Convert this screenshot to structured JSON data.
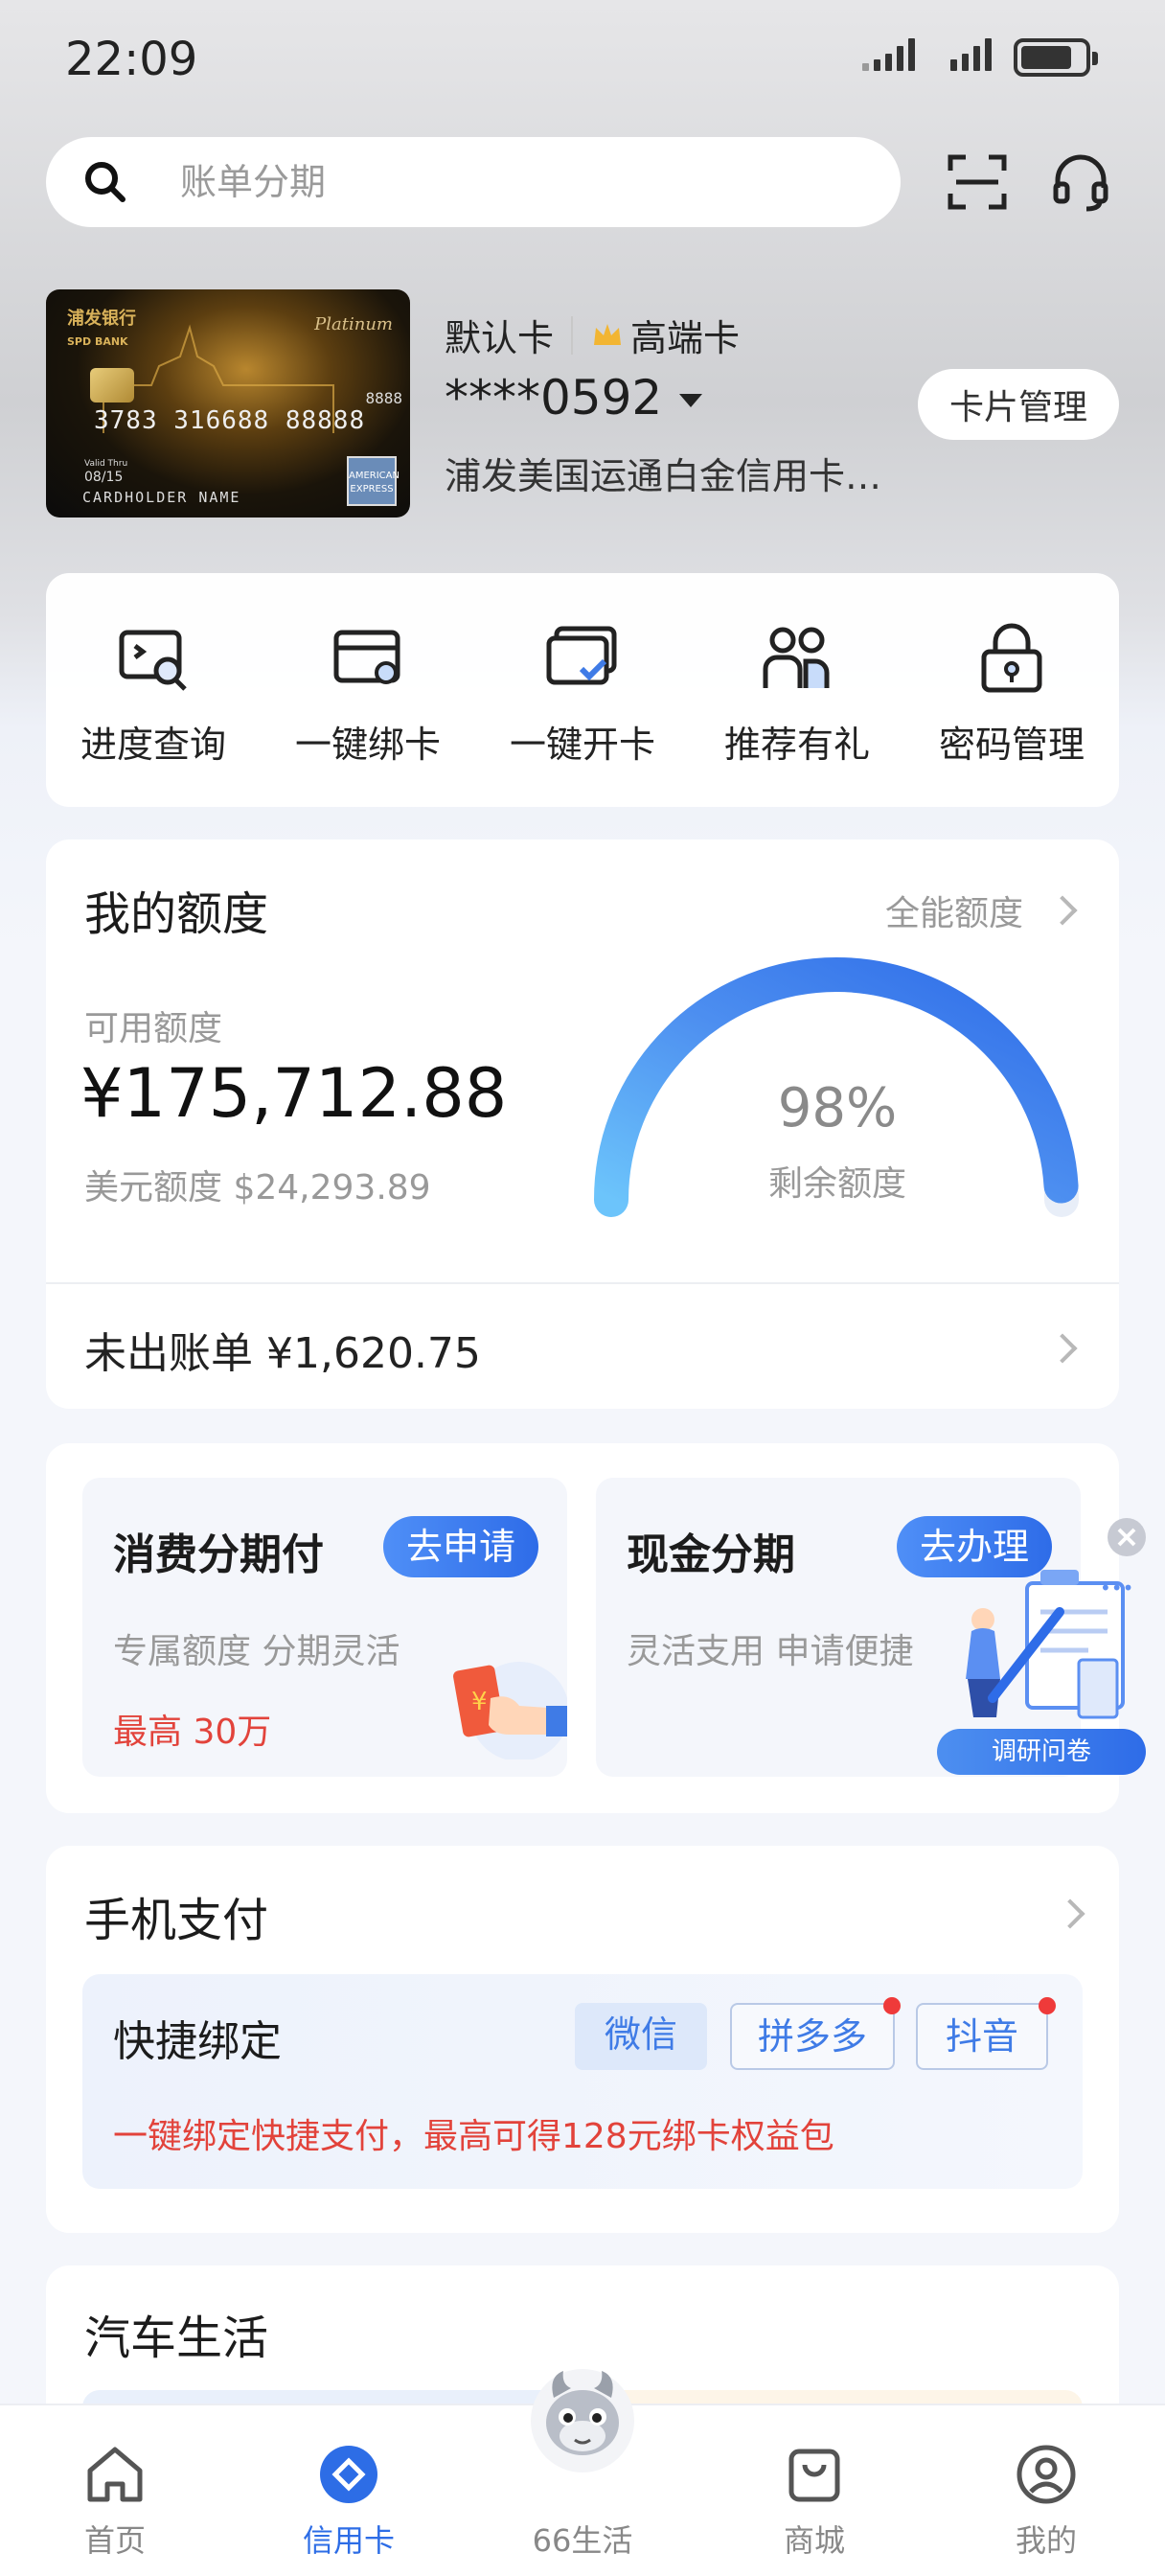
{
  "status": {
    "time": "22:09"
  },
  "search": {
    "placeholder": "账单分期"
  },
  "card": {
    "bank_name": "浦发银行",
    "bank_name_en": "SPD BANK",
    "tier_label": "Platinum",
    "card_number_art": "3783 316688 88888",
    "suffix_art": "8888",
    "valid_label": "Valid Thru",
    "expiry": "08/15",
    "holder": "CARDHOLDER NAME",
    "network": "AMERICAN EXPRESS",
    "default_label": "默认卡",
    "premium_label": "高端卡",
    "masked_number": "****0592",
    "name": "浦发美国运通白金信用卡…",
    "manage_label": "卡片管理"
  },
  "quick_actions": [
    {
      "label": "进度查询",
      "icon": "progress-search-icon"
    },
    {
      "label": "一键绑卡",
      "icon": "bind-card-icon"
    },
    {
      "label": "一键开卡",
      "icon": "activate-card-icon"
    },
    {
      "label": "推荐有礼",
      "icon": "referral-icon"
    },
    {
      "label": "密码管理",
      "icon": "lock-icon"
    }
  ],
  "credit": {
    "title": "我的额度",
    "all_quota_label": "全能额度",
    "available_label": "可用额度",
    "available_amount": "¥175,712.88",
    "usd_label": "美元额度 $24,293.89",
    "remaining_percent_text": "98%",
    "remaining_fraction": 0.98,
    "remaining_label": "剩余额度",
    "unbilled": "未出账单 ¥1,620.75"
  },
  "installments": [
    {
      "title": "消费分期付",
      "button": "去申请",
      "subtitle": "专属额度 分期灵活",
      "highlight": "最高 30万"
    },
    {
      "title": "现金分期",
      "button": "去办理",
      "subtitle": "灵活支用 申请便捷"
    }
  ],
  "survey": {
    "label": "调研问卷"
  },
  "mobile_pay": {
    "title": "手机支付",
    "quick_bind_title": "快捷绑定",
    "tags": [
      "微信",
      "拼多多",
      "抖音"
    ],
    "promo": "一键绑定快捷支付，最高可得128元绑卡权益包"
  },
  "car_life": {
    "title": "汽车生活"
  },
  "tabs": [
    {
      "label": "首页",
      "icon": "home-icon",
      "active": false
    },
    {
      "label": "信用卡",
      "icon": "credit-card-tab-icon",
      "active": true
    },
    {
      "label": "66生活",
      "icon": "dragon-mascot-icon",
      "active": false
    },
    {
      "label": "商城",
      "icon": "shopping-bag-icon",
      "active": false
    },
    {
      "label": "我的",
      "icon": "profile-icon",
      "active": false
    }
  ],
  "colors": {
    "accent": "#2d6de6",
    "alert": "#e2433b"
  }
}
